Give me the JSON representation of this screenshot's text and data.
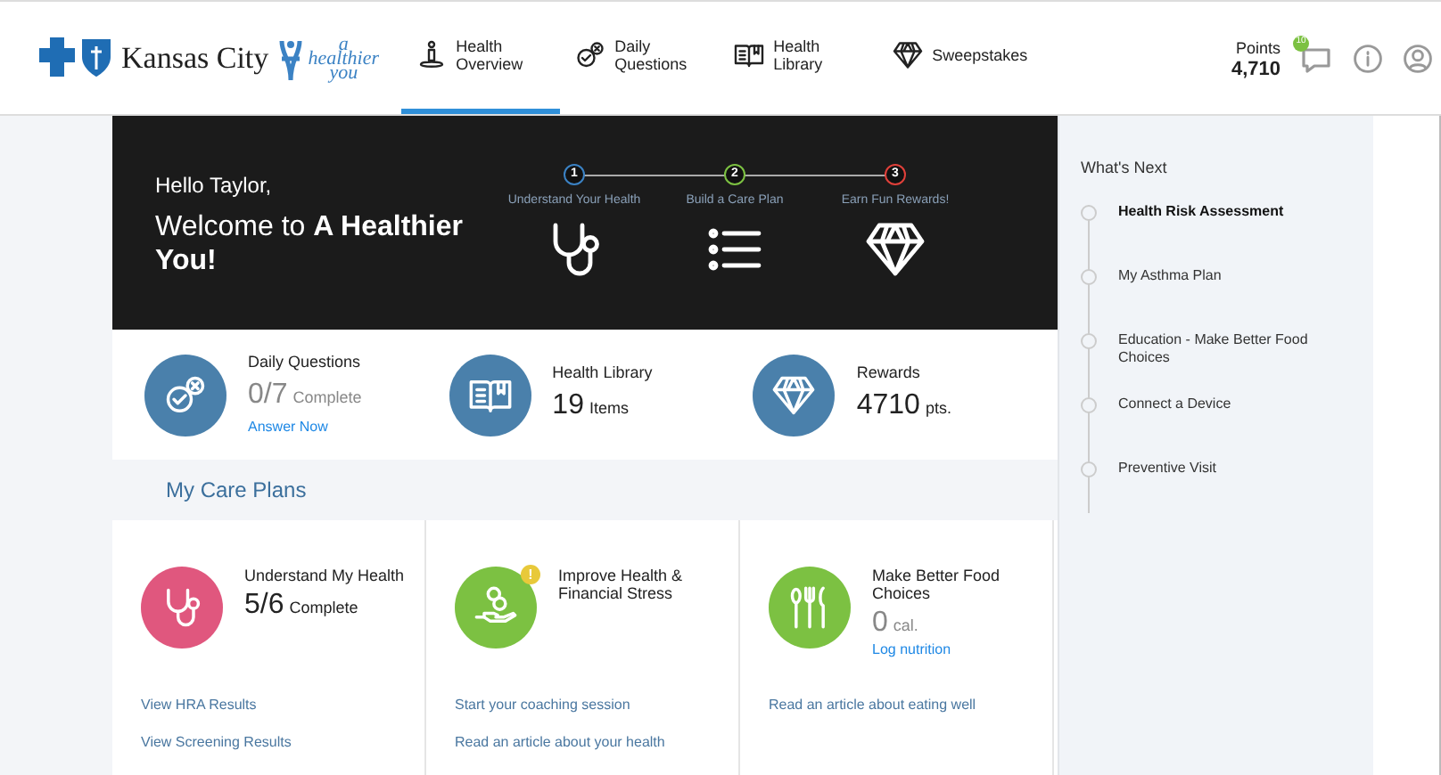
{
  "header": {
    "brand": "Kansas City",
    "tagline": [
      "a",
      "healthier",
      "you"
    ],
    "nav": [
      {
        "label": "Health Overview",
        "kind": "person",
        "selected": true
      },
      {
        "label": "Daily Questions",
        "kind": "check",
        "selected": false
      },
      {
        "label": "Health Library",
        "kind": "book",
        "selected": false
      },
      {
        "label": "Sweepstakes",
        "kind": "diamond",
        "selected": false
      }
    ],
    "points": {
      "label": "Points",
      "value": "4,710"
    },
    "chat_badge": "10"
  },
  "hero": {
    "greeting": "Hello Taylor,",
    "welcome": "Welcome to **A Healthier You!**",
    "steps": [
      {
        "number": "1",
        "label": "Understand Your Health",
        "color": "#3b82c4",
        "kind": "stethoscope"
      },
      {
        "number": "2",
        "label": "Build a Care Plan",
        "color": "#7cc142",
        "kind": "list"
      },
      {
        "number": "3",
        "label": "Earn Fun Rewards!",
        "color": "#e0403a",
        "kind": "diamond"
      }
    ]
  },
  "stats": [
    {
      "title": "Daily Questions",
      "value": "0/7",
      "unit": "Complete",
      "muted": true,
      "link": "Answer Now",
      "kind": "check"
    },
    {
      "title": "Health Library",
      "value": "19",
      "unit": "Items",
      "muted": false,
      "kind": "book"
    },
    {
      "title": "Rewards",
      "value": "4710",
      "unit": "pts.",
      "muted": false,
      "kind": "diamond"
    }
  ],
  "care_plans": {
    "title": "My Care Plans",
    "cards": [
      {
        "title": "Understand My Health",
        "value": "5/6",
        "unit": "Complete",
        "muted": false,
        "color": "#e0577e",
        "alert": false,
        "kind": "stethoscope",
        "links": [
          "View HRA Results",
          "View Screening Results"
        ]
      },
      {
        "title": "Improve Health & Financial Stress",
        "color": "#7cc142",
        "alert": true,
        "alert_mark": "!",
        "kind": "money",
        "links": [
          "Start your coaching session",
          "Read an article about your health"
        ]
      },
      {
        "title": "Make Better Food Choices",
        "value": "0",
        "unit": "cal.",
        "muted": true,
        "link": "Log nutrition",
        "color": "#7cc142",
        "alert": false,
        "kind": "utensils",
        "links": [
          "Read an article about eating well"
        ]
      }
    ]
  },
  "whats_next": {
    "title": "What's Next",
    "items": [
      {
        "label": "Health Risk Assessment",
        "current": true
      },
      {
        "label": "My Asthma Plan",
        "current": false
      },
      {
        "label": "Education - Make Better Food Choices",
        "current": false
      },
      {
        "label": "Connect a Device",
        "current": false
      },
      {
        "label": "Preventive Visit",
        "current": false
      }
    ]
  }
}
